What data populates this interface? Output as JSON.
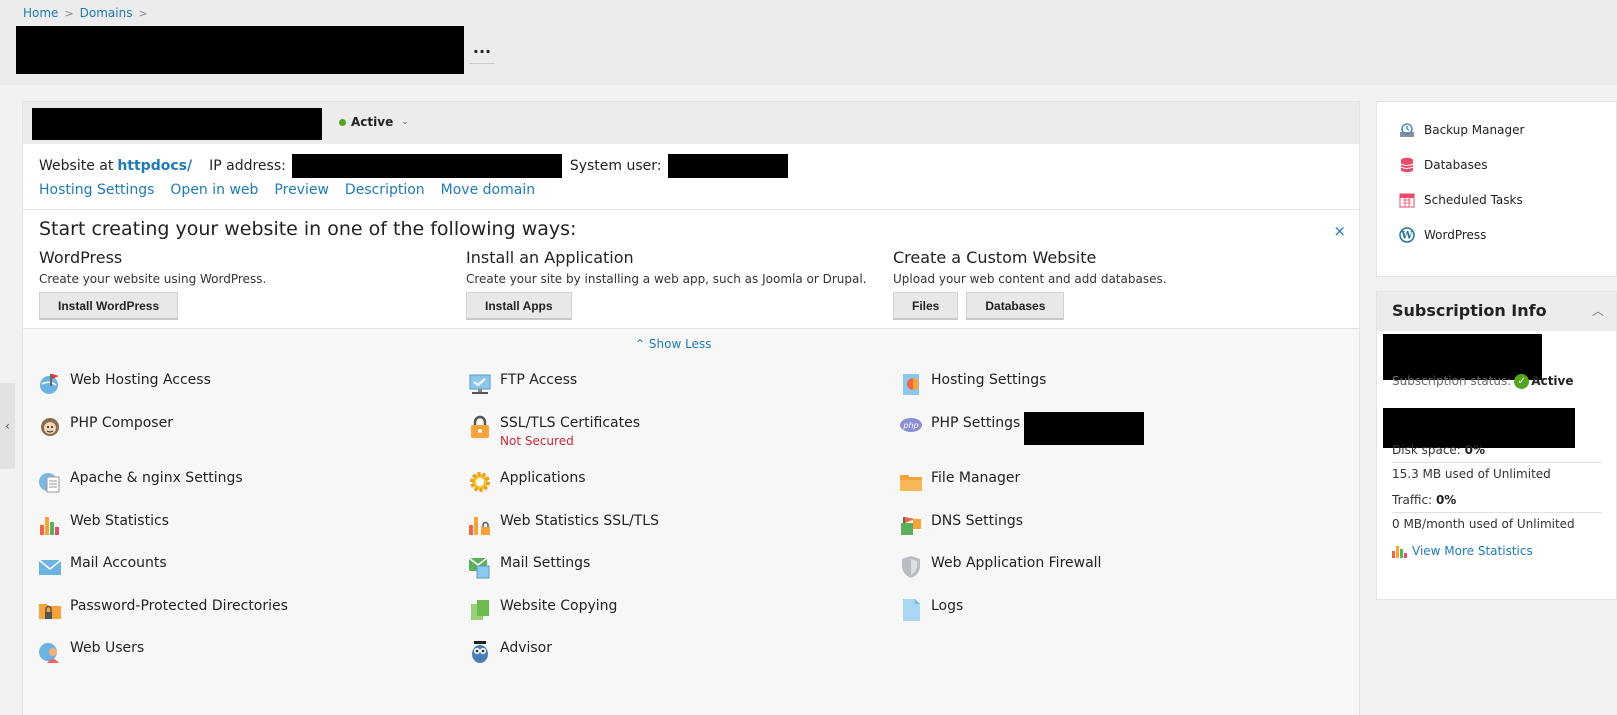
{
  "breadcrumb": {
    "home": "Home",
    "domains": "Domains",
    "sep": ">"
  },
  "header": {
    "more_label": "..."
  },
  "domain": {
    "status": "Active",
    "website_at_label": "Website at",
    "website_path": "httpdocs/",
    "ip_label": "IP address:",
    "system_user_label": "System user:"
  },
  "links": [
    "Hosting Settings",
    "Open in web",
    "Preview",
    "Description",
    "Move domain"
  ],
  "start": {
    "title": "Start creating your website in one of the following ways:",
    "close": "×",
    "ways": [
      {
        "title": "WordPress",
        "desc": "Create your website using WordPress.",
        "buttons": [
          "Install WordPress"
        ]
      },
      {
        "title": "Install an Application",
        "desc": "Create your site by installing a web app, such as Joomla or Drupal.",
        "buttons": [
          "Install Apps"
        ]
      },
      {
        "title": "Create a Custom Website",
        "desc": "Upload your web content and add databases.",
        "buttons": [
          "Files",
          "Databases"
        ]
      }
    ]
  },
  "show_less": "Show Less",
  "tools": [
    {
      "label": "Web Hosting Access",
      "icon": "globe-flag-icon"
    },
    {
      "label": "FTP Access",
      "icon": "ftp-monitor-icon"
    },
    {
      "label": "Hosting Settings",
      "icon": "hosting-settings-icon"
    },
    {
      "label": "PHP Composer",
      "icon": "composer-icon"
    },
    {
      "label": "SSL/TLS Certificates",
      "icon": "lock-icon",
      "sub": "Not Secured"
    },
    {
      "label": "PHP Settings",
      "icon": "php-icon"
    },
    {
      "label": "Apache & nginx Settings",
      "icon": "apache-icon"
    },
    {
      "label": "Applications",
      "icon": "gear-icon"
    },
    {
      "label": "File Manager",
      "icon": "folder-icon"
    },
    {
      "label": "Web Statistics",
      "icon": "bar-chart-icon"
    },
    {
      "label": "Web Statistics SSL/TLS",
      "icon": "bar-chart-lock-icon"
    },
    {
      "label": "DNS Settings",
      "icon": "dns-flag-icon"
    },
    {
      "label": "Mail Accounts",
      "icon": "envelope-icon"
    },
    {
      "label": "Mail Settings",
      "icon": "mail-settings-icon"
    },
    {
      "label": "Web Application Firewall",
      "icon": "shield-icon"
    },
    {
      "label": "Password-Protected Directories",
      "icon": "locked-folder-icon"
    },
    {
      "label": "Website Copying",
      "icon": "copy-icon"
    },
    {
      "label": "Logs",
      "icon": "document-icon"
    },
    {
      "label": "Web Users",
      "icon": "web-users-icon"
    },
    {
      "label": "Advisor",
      "icon": "owl-icon"
    }
  ],
  "side": {
    "items": [
      {
        "label": "Backup Manager",
        "icon": "backup-icon"
      },
      {
        "label": "Databases",
        "icon": "database-icon"
      },
      {
        "label": "Scheduled Tasks",
        "icon": "calendar-icon"
      },
      {
        "label": "WordPress",
        "icon": "wordpress-icon"
      }
    ]
  },
  "subscription": {
    "title": "Subscription Info",
    "status_label": "Subscription status:",
    "status_value": "Active",
    "disk_label": "Disk space:",
    "disk_value": "0%",
    "disk_usage": "15.3 MB used of Unlimited",
    "traffic_label": "Traffic:",
    "traffic_value": "0%",
    "traffic_usage": "0 MB/month used of Unlimited",
    "more_stats": "View More Statistics"
  },
  "colors": {
    "accent": "#1f7bb6",
    "active": "#53a51d",
    "error": "#c72939"
  }
}
